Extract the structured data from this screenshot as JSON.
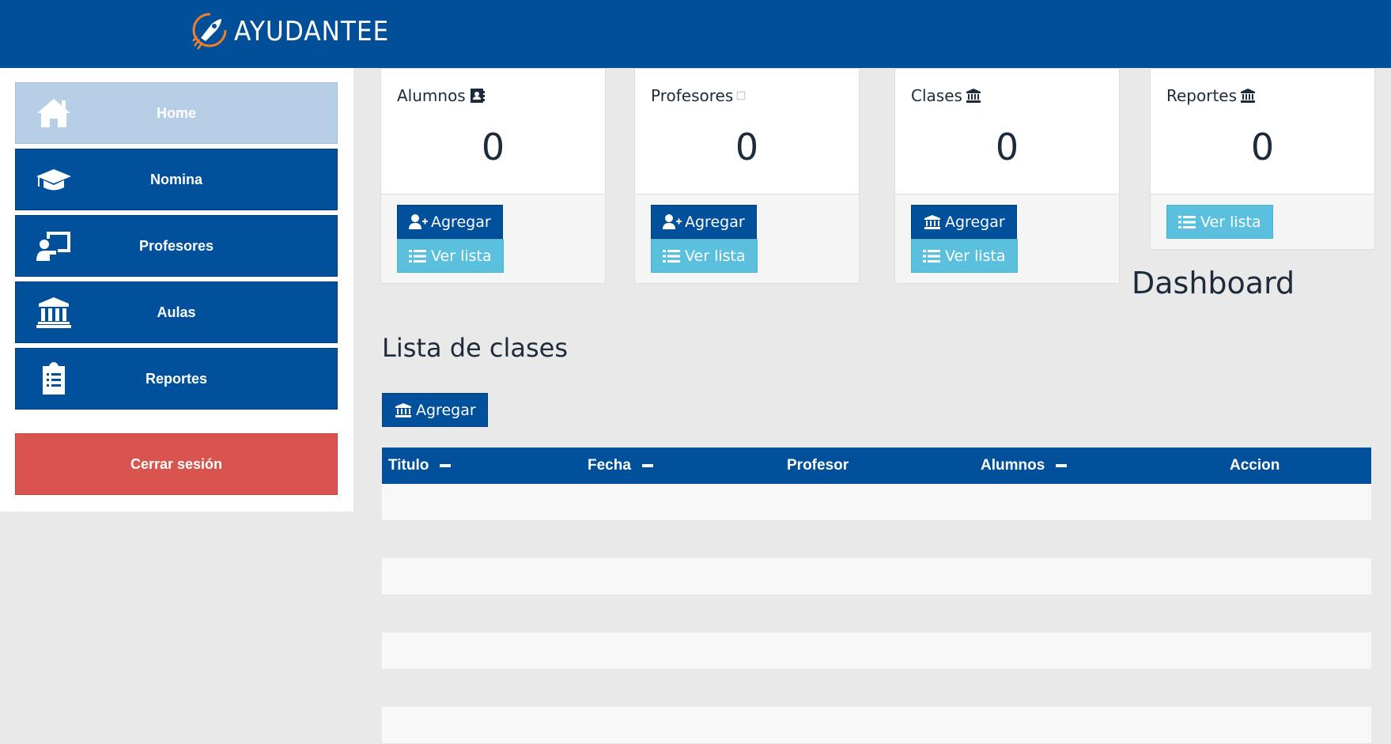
{
  "header": {
    "brand": "AYUDANTEE",
    "brand_icon": "rocket-icon"
  },
  "sidebar": {
    "items": [
      {
        "label": "Home",
        "icon": "home-icon",
        "active": true
      },
      {
        "label": "Nomina",
        "icon": "graduation-cap-icon",
        "active": false
      },
      {
        "label": "Profesores",
        "icon": "teacher-board-icon",
        "active": false
      },
      {
        "label": "Aulas",
        "icon": "university-icon",
        "active": false
      },
      {
        "label": "Reportes",
        "icon": "clipboard-list-icon",
        "active": false
      }
    ],
    "logout": "Cerrar sesión"
  },
  "cards": [
    {
      "title": "Alumnos",
      "icon": "address-book-icon",
      "count": "0",
      "add": "Agregar",
      "list": "Ver lista"
    },
    {
      "title": "Profesores",
      "icon": "missing-glyph-icon",
      "count": "0",
      "add": "Agregar",
      "list": "Ver lista"
    },
    {
      "title": "Clases",
      "icon": "university-icon",
      "count": "0",
      "add": "Agregar",
      "list": "Ver lista"
    },
    {
      "title": "Reportes",
      "icon": "university-icon",
      "count": "0",
      "list": "Ver lista"
    }
  ],
  "main": {
    "dashboard_title": "Dashboard",
    "section_title": "Lista de clases",
    "add_button": "Agregar",
    "table": {
      "columns": [
        "Titulo",
        "Fecha",
        "Profesor",
        "Alumnos",
        "Accion"
      ]
    }
  },
  "colors": {
    "primary": "#00509c",
    "info": "#5bc0de",
    "danger": "#d9534f",
    "active": "#b7cfe6"
  }
}
